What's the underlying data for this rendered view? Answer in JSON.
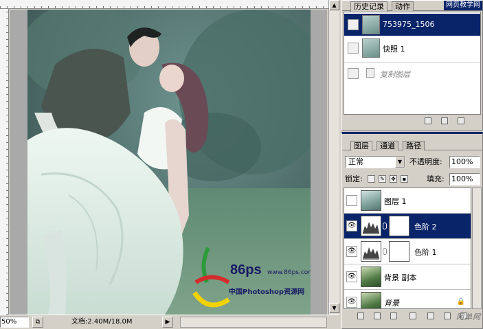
{
  "document": {
    "zoom": "50%",
    "doc_size": "文档:2.40M/18.0M"
  },
  "logo": {
    "brand": "86ps",
    "url": "www.86ps.com",
    "slogan": "中国Photoshop资源网"
  },
  "history_panel": {
    "tabs": [
      "历史记录",
      "动作"
    ],
    "watermark": "网页教学网",
    "items": [
      {
        "label": "753975_1506",
        "state": "selected"
      },
      {
        "label": "快照 1",
        "state": "normal"
      },
      {
        "label": "复制图层",
        "state": "step"
      }
    ]
  },
  "layers_panel": {
    "tabs": [
      "图层",
      "通道",
      "路径"
    ],
    "blend_mode": "正常",
    "opacity_label": "不透明度:",
    "opacity_value": "100%",
    "lock_label": "锁定:",
    "fill_label": "填充:",
    "fill_value": "100%",
    "layers": [
      {
        "name": "图层 1",
        "visible": false,
        "selected": false,
        "kind": "pixel"
      },
      {
        "name": "色阶 2",
        "visible": true,
        "selected": true,
        "kind": "adjustment"
      },
      {
        "name": "色阶 1",
        "visible": true,
        "selected": false,
        "kind": "adjustment"
      },
      {
        "name": "背景 副本",
        "visible": true,
        "selected": false,
        "kind": "pixel"
      },
      {
        "name": "背景",
        "visible": true,
        "selected": false,
        "kind": "background"
      }
    ],
    "footer_watermark": "网单网"
  },
  "icons": {
    "eye": "eye-icon",
    "chain": "link-icon",
    "lock": "lock-icon"
  }
}
